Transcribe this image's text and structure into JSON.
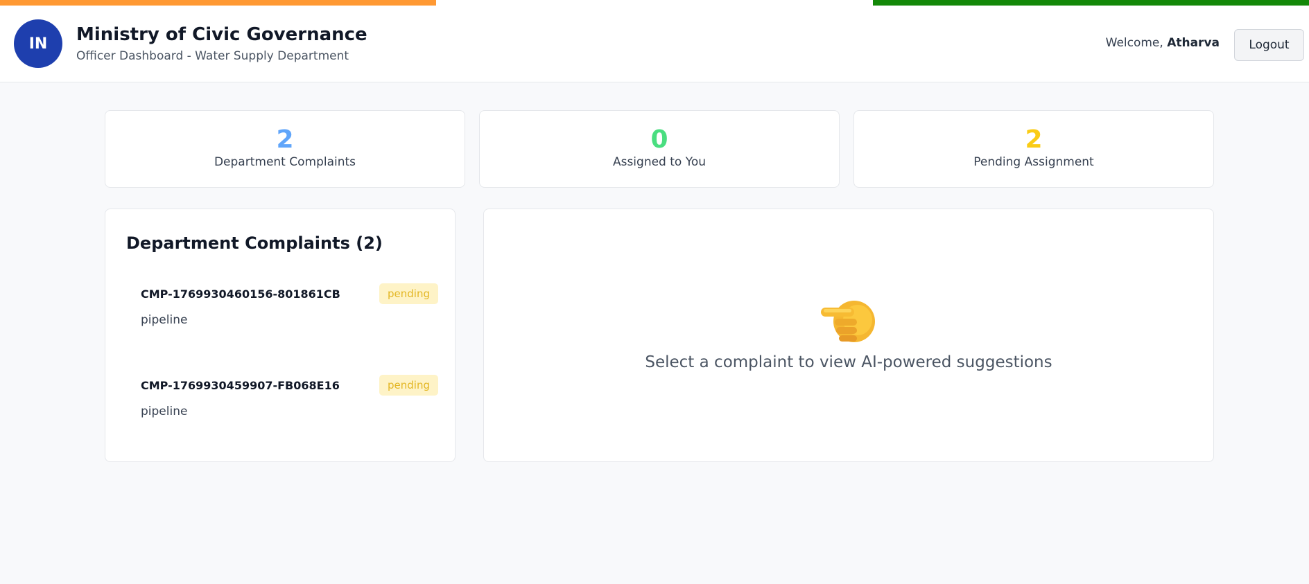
{
  "colors": {
    "saffron": "#ff9933",
    "white": "#ffffff",
    "green": "#138808",
    "blue_stat": "#60a5fa",
    "green_stat": "#4ade80",
    "yellow_stat": "#facc15",
    "emblem": "#1e3fae"
  },
  "header": {
    "emblem_text": "IN",
    "title": "Ministry of Civic Governance",
    "subtitle": "Officer Dashboard - Water Supply Department",
    "welcome_prefix": "Welcome, ",
    "user_name": "Atharva",
    "logout_label": "Logout"
  },
  "stats": [
    {
      "value": "2",
      "label": "Department Complaints"
    },
    {
      "value": "0",
      "label": "Assigned to You"
    },
    {
      "value": "2",
      "label": "Pending Assignment"
    }
  ],
  "complaints_panel": {
    "title": "Department Complaints (2)",
    "items": [
      {
        "id": "CMP-1769930460156-801861CB",
        "category": "pipeline",
        "status": "pending"
      },
      {
        "id": "CMP-1769930459907-FB068E16",
        "category": "pipeline",
        "status": "pending"
      }
    ]
  },
  "detail_panel": {
    "icon": "pointing-hand-icon",
    "message": "Select a complaint to view AI-powered suggestions"
  }
}
